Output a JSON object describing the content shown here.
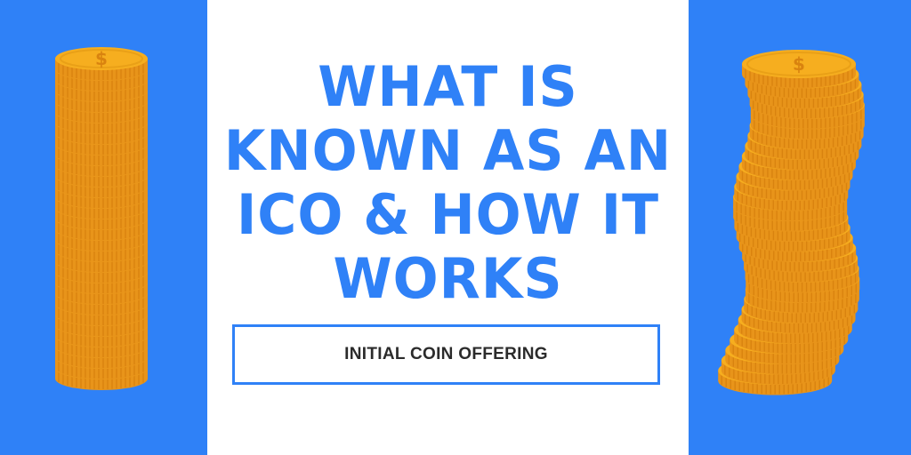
{
  "headline": {
    "lines": [
      "WHAT IS",
      "KNOWN AS AN",
      "ICO & HOW IT",
      "WORKS"
    ]
  },
  "subtitle": "INITIAL COIN OFFERING",
  "colors": {
    "panel_blue": "#2f81f7",
    "headline_blue": "#2f81f7",
    "coin_gold": "#f6ae1f",
    "coin_edge": "#e8941a",
    "subtitle_text": "#2b2b2b"
  },
  "icons": {
    "left": "straight-coin-stack-icon",
    "right": "leaning-coin-stack-icon",
    "coin_symbol": "dollar-sign"
  },
  "coin_symbol": "$"
}
